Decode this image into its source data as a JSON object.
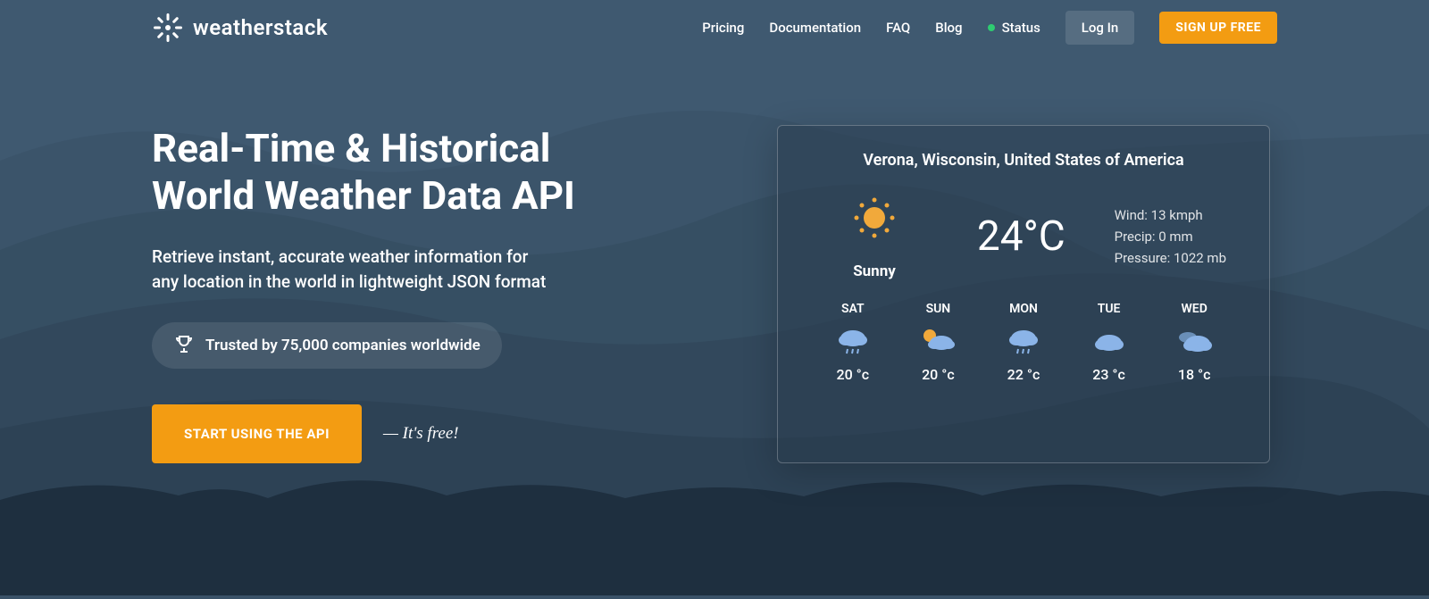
{
  "brand": "weatherstack",
  "nav": {
    "pricing": "Pricing",
    "documentation": "Documentation",
    "faq": "FAQ",
    "blog": "Blog",
    "status": "Status",
    "login": "Log In",
    "signup": "SIGN UP FREE"
  },
  "hero": {
    "title_line1": "Real-Time & Historical",
    "title_line2": "World Weather Data API",
    "subtitle_line1": "Retrieve instant, accurate weather information for",
    "subtitle_line2": "any location in the world in lightweight JSON format",
    "trusted": "Trusted by 75,000 companies worldwide",
    "cta": "START USING THE API",
    "cta_note": "— It's free!"
  },
  "weather": {
    "location": "Verona, Wisconsin, United States of America",
    "condition": "Sunny",
    "temp": "24°C",
    "wind": "Wind: 13 kmph",
    "precip": "Precip: 0 mm",
    "pressure": "Pressure: 1022 mb",
    "forecast": [
      {
        "day": "SAT",
        "temp": "20 °c",
        "icon": "rain"
      },
      {
        "day": "SUN",
        "temp": "20 °c",
        "icon": "partly"
      },
      {
        "day": "MON",
        "temp": "22 °c",
        "icon": "rain"
      },
      {
        "day": "TUE",
        "temp": "23 °c",
        "icon": "cloud"
      },
      {
        "day": "WED",
        "temp": "18 °c",
        "icon": "cloudy"
      }
    ]
  }
}
